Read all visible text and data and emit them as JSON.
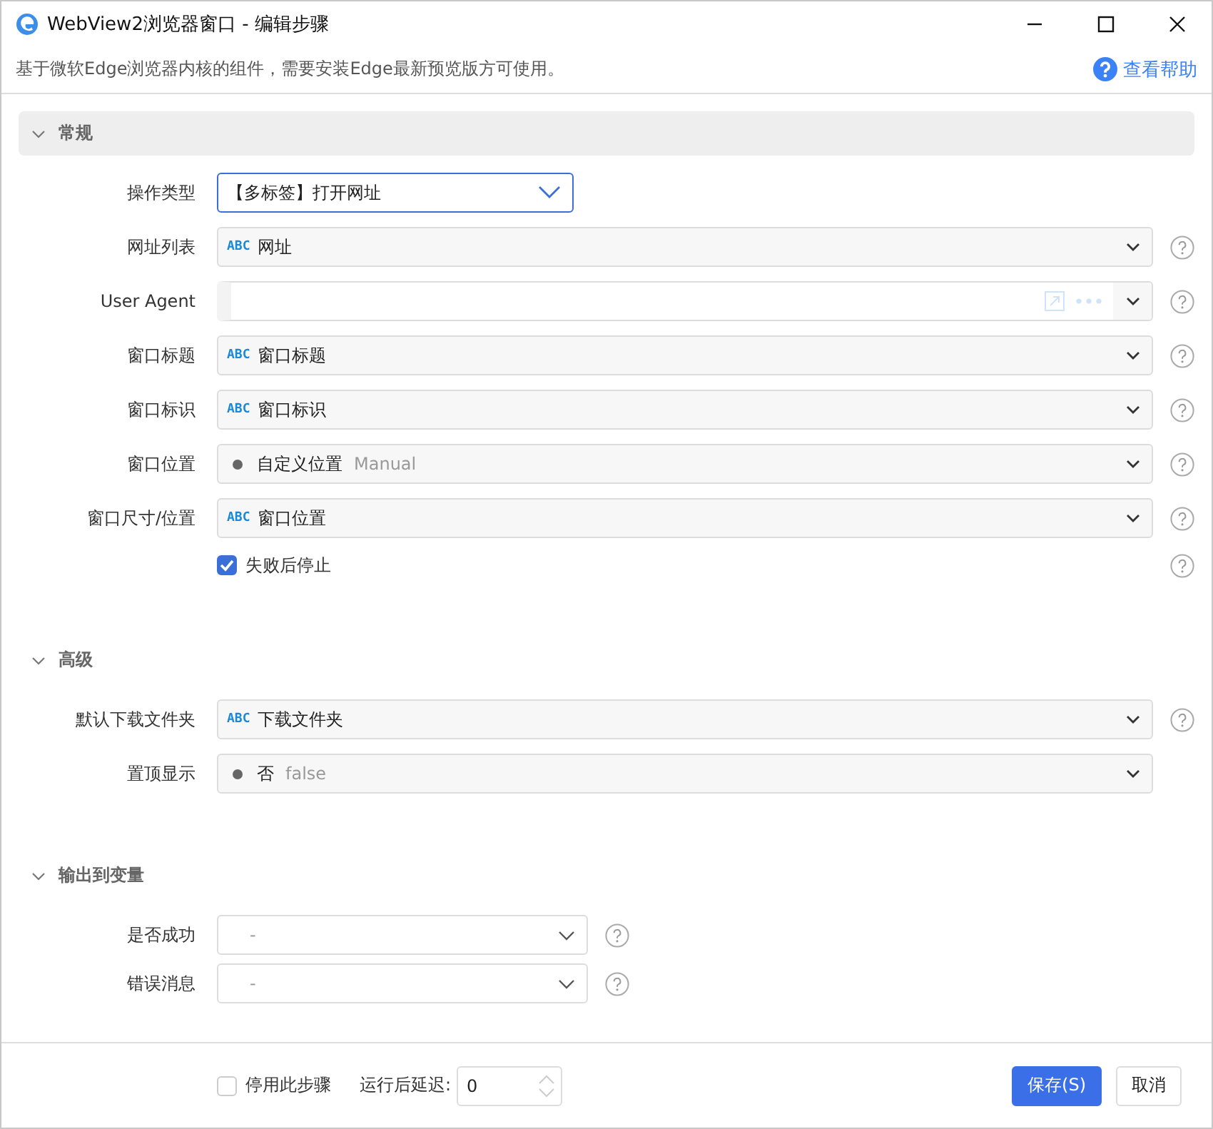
{
  "window": {
    "title": "WebView2浏览器窗口  -  编辑步骤"
  },
  "description": "基于微软Edge浏览器内核的组件，需要安装Edge最新预览版方可使用。",
  "help_link": "查看帮助",
  "sections": [
    {
      "title": "常规",
      "expanded": true,
      "selected": true,
      "fields": [
        {
          "kind": "select",
          "label": "操作类型",
          "value": "【多标签】打开网址",
          "help": false
        },
        {
          "kind": "abc",
          "label": "网址列表",
          "prefix": "ABC",
          "value": "网址",
          "help": true
        },
        {
          "kind": "text",
          "label": "User Agent",
          "help": true
        },
        {
          "kind": "abc",
          "label": "窗口标题",
          "prefix": "ABC",
          "value": "窗口标题",
          "help": true
        },
        {
          "kind": "abc",
          "label": "窗口标识",
          "prefix": "ABC",
          "value": "窗口标识",
          "help": true
        },
        {
          "kind": "enum",
          "label": "窗口位置",
          "value": "自定义位置",
          "hint": "Manual",
          "help": true
        },
        {
          "kind": "abc",
          "label": "窗口尺寸/位置",
          "prefix": "ABC",
          "value": "窗口位置",
          "help": true
        },
        {
          "kind": "checkbox",
          "label": "失败后停止",
          "checked": true,
          "help": true
        }
      ]
    },
    {
      "title": "高级",
      "expanded": true,
      "selected": false,
      "fields": [
        {
          "kind": "abc",
          "label": "默认下载文件夹",
          "prefix": "ABC",
          "value": "下载文件夹",
          "help": true
        },
        {
          "kind": "enum",
          "label": "置顶显示",
          "value": "否",
          "hint": "false",
          "help": false
        }
      ]
    },
    {
      "title": "输出到变量",
      "expanded": true,
      "selected": false,
      "fields": [
        {
          "kind": "variable",
          "label": "是否成功",
          "value": "-",
          "help": true
        },
        {
          "kind": "variable",
          "label": "错误消息",
          "value": "-",
          "help": true
        }
      ]
    }
  ],
  "footer": {
    "disable_step": {
      "label": "停用此步骤",
      "checked": false
    },
    "delay_label": "运行后延迟:",
    "delay_value": "0",
    "buttons": [
      {
        "label": "保存(S)",
        "primary": true
      },
      {
        "label": "取消",
        "primary": false
      }
    ]
  }
}
